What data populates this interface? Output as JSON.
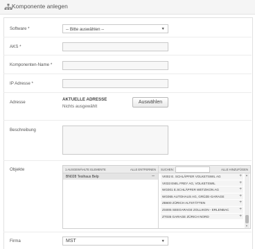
{
  "header": {
    "title": "Komponente anlegen",
    "icon": "sitemap-icon"
  },
  "fields": {
    "software": {
      "label": "Software *",
      "value": "-- Bitte auswählen --"
    },
    "aks": {
      "label": "AKS *",
      "value": ""
    },
    "komponenten_name": {
      "label": "Komponenten-Name *",
      "value": ""
    },
    "ip_adresse": {
      "label": "IP Adresse *",
      "value": ""
    },
    "adresse": {
      "label": "Adresse",
      "current_title": "AKTUELLE ADRESSE",
      "current_value": "Nichts ausgewählt",
      "button": "Auswählen"
    },
    "beschreibung": {
      "label": "Beschreibung",
      "value": ""
    },
    "objekte": {
      "label": "Objekte",
      "selected_header": "1 AUSGEWÄHLTE ELEMENTE",
      "remove_all": "ALLE ENTFERNEN",
      "search_label": "SUCHEN:",
      "add_all": "ALLE HINZUFÜGEN",
      "selected": [
        "BN028 Tesihaus Belp"
      ],
      "available": [
        "VI002 E. SCHLÄPFER VOLKETSWIL AG",
        "VI033 EMIL FREY AG, VOLKETSWIL",
        "WG001 E.SCHLÄPFER WETZIKON AG",
        "WG065 AUTOHAUS AG, GRÜZE-GARAGE",
        "ZB600 ZÜRICH ALTSTÄTTEN",
        "ZS005 SEEGARAGE ZOLLIKON - ERLENBAC",
        "ZT035 GARAGE ZÜRICH NORD"
      ]
    },
    "firma": {
      "label": "Firma",
      "value": "MST"
    }
  }
}
